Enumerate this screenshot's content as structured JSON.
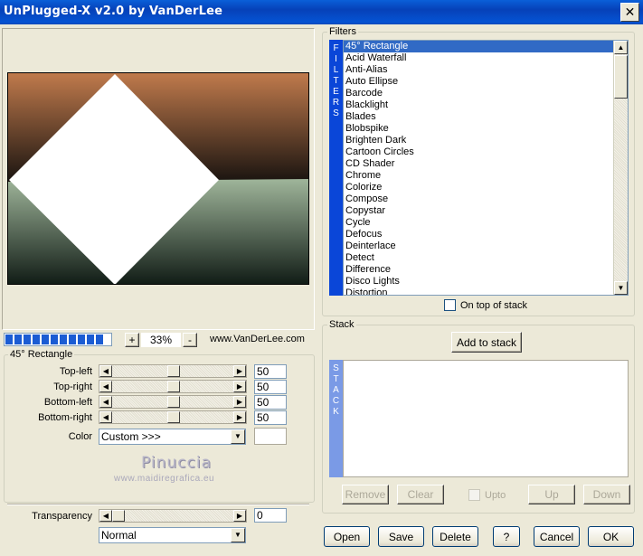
{
  "window": {
    "title": "UnPlugged-X v2.0 by VanDerLee",
    "close": "✕"
  },
  "preview": {
    "colors": {
      "top": "#c07a4c",
      "mid": "#1a1410",
      "green_top": "#9fb59a",
      "green_bottom": "#0f1a14",
      "shape": "#ffffff"
    }
  },
  "zoom": {
    "minus": "-",
    "plus": "+",
    "value": "33%",
    "progress_fraction": 1.0
  },
  "credit": "www.VanDerLee.com",
  "params": {
    "group_title": "45° Rectangle",
    "rows": [
      {
        "label": "Top-left",
        "value": "50"
      },
      {
        "label": "Top-right",
        "value": "50"
      },
      {
        "label": "Bottom-left",
        "value": "50"
      },
      {
        "label": "Bottom-right",
        "value": "50"
      }
    ],
    "color_label": "Color",
    "color_value": "Custom >>>"
  },
  "watermark": {
    "name": "Pinuccia",
    "site": "www.maidiregrafica.eu"
  },
  "transparency": {
    "label": "Transparency",
    "value": "0",
    "blend": "Normal"
  },
  "filters": {
    "group_title": "Filters",
    "vertical_label": [
      "F",
      "I",
      "L",
      "T",
      "E",
      "R",
      "S"
    ],
    "items": [
      "45° Rectangle",
      "Acid Waterfall",
      "Anti-Alias",
      "Auto Ellipse",
      "Barcode",
      "Blacklight",
      "Blades",
      "Blobspike",
      "Brighten Dark",
      "Cartoon Circles",
      "CD Shader",
      "Chrome",
      "Colorize",
      "Compose",
      "Copystar",
      "Cycle",
      "Defocus",
      "Deinterlace",
      "Detect",
      "Difference",
      "Disco Lights",
      "Distortion"
    ],
    "selected_index": 0,
    "on_top_label": "On top of stack"
  },
  "stack": {
    "group_title": "Stack",
    "add_label": "Add to stack",
    "vertical_label": [
      "S",
      "T",
      "A",
      "C",
      "K"
    ],
    "remove": "Remove",
    "clear": "Clear",
    "upto": "Upto",
    "up": "Up",
    "down": "Down"
  },
  "buttons": {
    "open": "Open",
    "save": "Save",
    "delete": "Delete",
    "help": "?",
    "cancel": "Cancel",
    "ok": "OK"
  }
}
